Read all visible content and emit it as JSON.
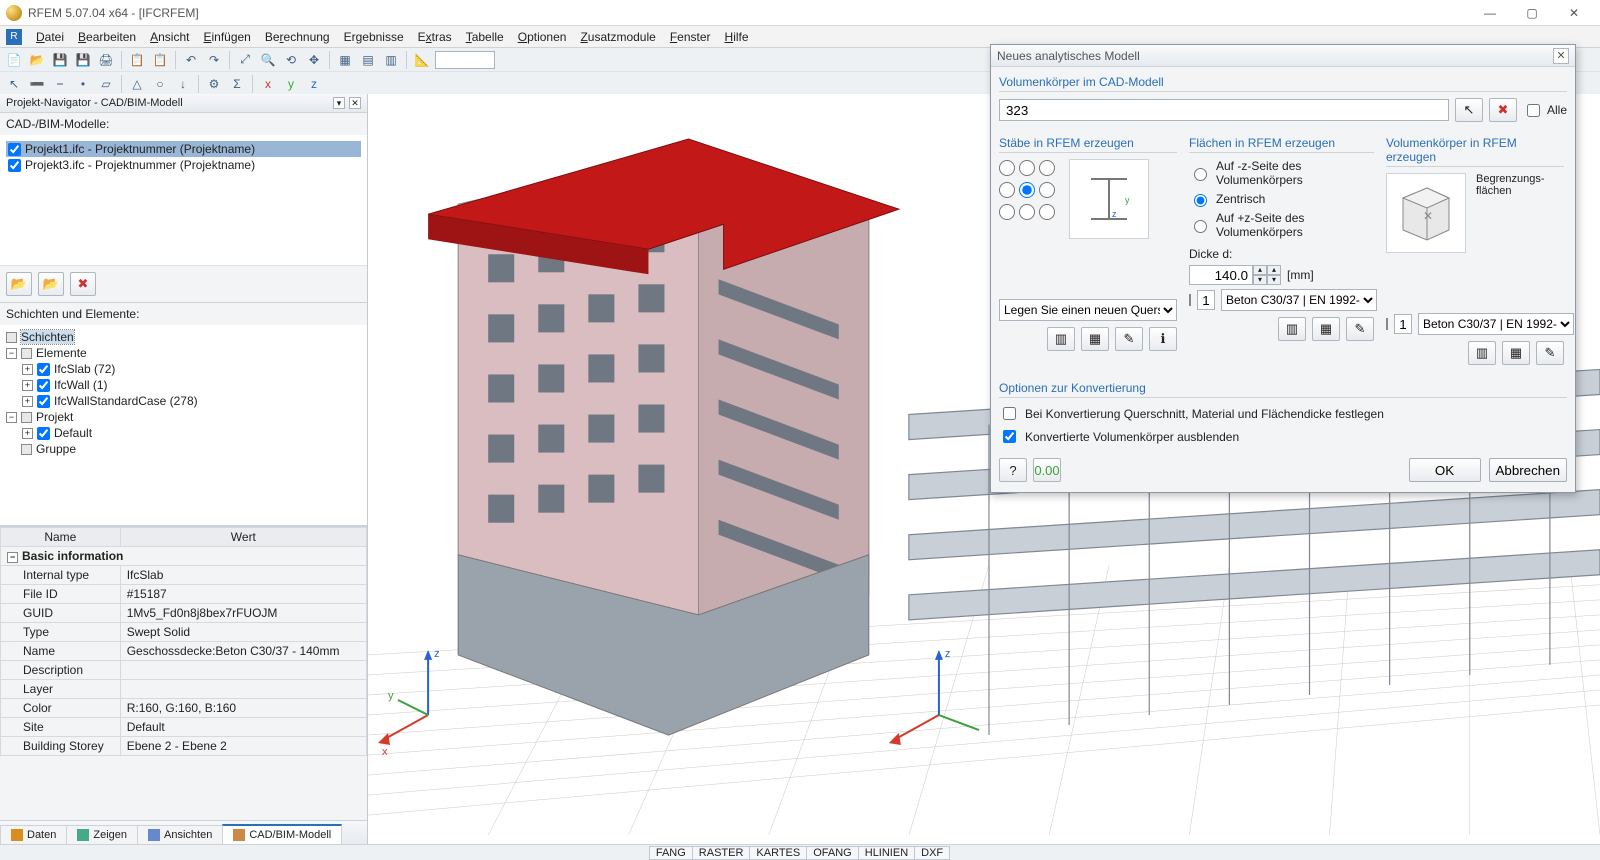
{
  "app": {
    "title": "RFEM 5.07.04 x64 - [IFCRFEM]"
  },
  "menu": [
    "Datei",
    "Bearbeiten",
    "Ansicht",
    "Einfügen",
    "Berechnung",
    "Ergebnisse",
    "Extras",
    "Tabelle",
    "Optionen",
    "Zusatzmodule",
    "Fenster",
    "Hilfe"
  ],
  "navigator": {
    "title": "Projekt-Navigator - CAD/BIM-Modell",
    "models_label": "CAD-/BIM-Modelle:",
    "models": [
      {
        "label": "Projekt1.ifc - Projektnummer (Projektname)",
        "checked": true,
        "selected": true
      },
      {
        "label": "Projekt3.ifc - Projektnummer (Projektname)",
        "checked": true,
        "selected": false
      }
    ],
    "layers_label": "Schichten und Elemente:",
    "tree": {
      "schichten": "Schichten",
      "elemente": "Elemente",
      "ifcslab": "IfcSlab (72)",
      "ifcwall": "IfcWall (1)",
      "ifcwallstd": "IfcWallStandardCase (278)",
      "projekt": "Projekt",
      "default_": "Default",
      "gruppe": "Gruppe"
    },
    "props": {
      "header_name": "Name",
      "header_value": "Wert",
      "category": "Basic information",
      "rows": [
        {
          "k": "Internal type",
          "v": "IfcSlab"
        },
        {
          "k": "File ID",
          "v": "#15187"
        },
        {
          "k": "GUID",
          "v": "1Mv5_Fd0n8j8bex7rFUOJM"
        },
        {
          "k": "Type",
          "v": "Swept Solid"
        },
        {
          "k": "Name",
          "v": "Geschossdecke:Beton C30/37 - 140mm"
        },
        {
          "k": "Description",
          "v": ""
        },
        {
          "k": "Layer",
          "v": ""
        },
        {
          "k": "Color",
          "v": "R:160, G:160, B:160"
        },
        {
          "k": "Site",
          "v": "Default"
        },
        {
          "k": "Building Storey",
          "v": "Ebene 2 - Ebene 2"
        }
      ]
    },
    "tabs": [
      "Daten",
      "Zeigen",
      "Ansichten",
      "CAD/BIM-Modell"
    ]
  },
  "dialog": {
    "title": "Neues analytisches Modell",
    "group1_title": "Volumenkörper im CAD-Modell",
    "solids_input": "323",
    "alle_label": "Alle",
    "col1_title": "Stäbe in RFEM erzeugen",
    "col1_placeholder": "Legen Sie einen neuen Querschnitt",
    "col2_title": "Flächen in RFEM erzeugen",
    "radio_opts": [
      "Auf -z-Seite des Volumenkörpers",
      "Zentrisch",
      "Auf +z-Seite des Volumenkörpers"
    ],
    "thickness_label": "Dicke d:",
    "thickness_value": "140.0",
    "thickness_unit": "[mm]",
    "material_left_num": "1",
    "material_left": "Beton C30/37 | EN 1992-",
    "col3_title": "Volumenkörper in RFEM erzeugen",
    "col3_box_label": "Begrenzungs-\nflächen",
    "material_right_num": "1",
    "material_right": "Beton C30/37 | EN 1992-",
    "options_title": "Optionen zur Konvertierung",
    "opt1": "Bei Konvertierung Querschnitt, Material und Flächendicke festlegen",
    "opt2": "Konvertierte Volumenkörper ausblenden",
    "ok": "OK",
    "cancel": "Abbrechen"
  },
  "statusbar": [
    "FANG",
    "RASTER",
    "KARTES",
    "OFANG",
    "HLINIEN",
    "DXF"
  ]
}
